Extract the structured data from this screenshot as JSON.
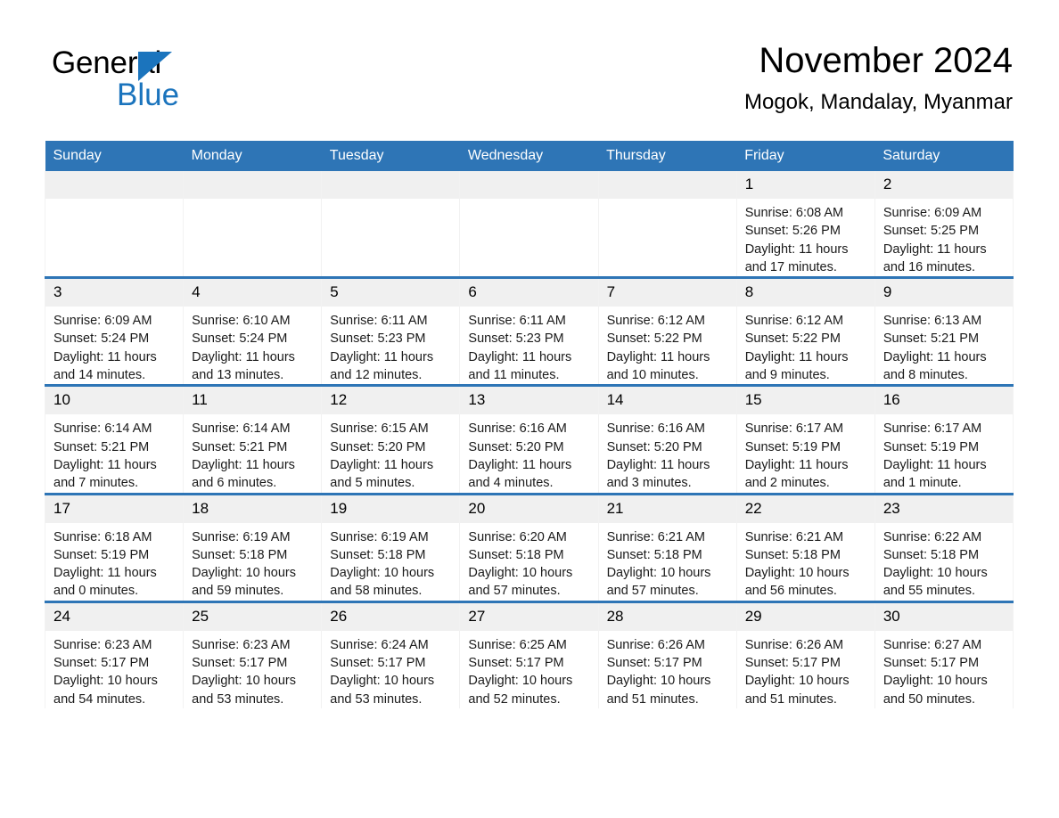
{
  "brand": {
    "name_part1": "General",
    "name_part2": "Blue",
    "triangle_color": "#1b74bd"
  },
  "header": {
    "title": "November 2024",
    "location": "Mogok, Mandalay, Myanmar"
  },
  "theme": {
    "header_blue": "#2e75b6",
    "daynum_bg": "#f0f0f0",
    "text": "#000000"
  },
  "weekday_headers": [
    "Sunday",
    "Monday",
    "Tuesday",
    "Wednesday",
    "Thursday",
    "Friday",
    "Saturday"
  ],
  "labels": {
    "sunrise_prefix": "Sunrise:",
    "sunset_prefix": "Sunset:",
    "daylight_prefix": "Daylight:"
  },
  "weeks": [
    [
      {
        "day": "",
        "sunrise": "",
        "sunset": "",
        "daylight_line1": "",
        "daylight_line2": ""
      },
      {
        "day": "",
        "sunrise": "",
        "sunset": "",
        "daylight_line1": "",
        "daylight_line2": ""
      },
      {
        "day": "",
        "sunrise": "",
        "sunset": "",
        "daylight_line1": "",
        "daylight_line2": ""
      },
      {
        "day": "",
        "sunrise": "",
        "sunset": "",
        "daylight_line1": "",
        "daylight_line2": ""
      },
      {
        "day": "",
        "sunrise": "",
        "sunset": "",
        "daylight_line1": "",
        "daylight_line2": ""
      },
      {
        "day": "1",
        "sunrise": "Sunrise: 6:08 AM",
        "sunset": "Sunset: 5:26 PM",
        "daylight_line1": "Daylight: 11 hours",
        "daylight_line2": "and 17 minutes."
      },
      {
        "day": "2",
        "sunrise": "Sunrise: 6:09 AM",
        "sunset": "Sunset: 5:25 PM",
        "daylight_line1": "Daylight: 11 hours",
        "daylight_line2": "and 16 minutes."
      }
    ],
    [
      {
        "day": "3",
        "sunrise": "Sunrise: 6:09 AM",
        "sunset": "Sunset: 5:24 PM",
        "daylight_line1": "Daylight: 11 hours",
        "daylight_line2": "and 14 minutes."
      },
      {
        "day": "4",
        "sunrise": "Sunrise: 6:10 AM",
        "sunset": "Sunset: 5:24 PM",
        "daylight_line1": "Daylight: 11 hours",
        "daylight_line2": "and 13 minutes."
      },
      {
        "day": "5",
        "sunrise": "Sunrise: 6:11 AM",
        "sunset": "Sunset: 5:23 PM",
        "daylight_line1": "Daylight: 11 hours",
        "daylight_line2": "and 12 minutes."
      },
      {
        "day": "6",
        "sunrise": "Sunrise: 6:11 AM",
        "sunset": "Sunset: 5:23 PM",
        "daylight_line1": "Daylight: 11 hours",
        "daylight_line2": "and 11 minutes."
      },
      {
        "day": "7",
        "sunrise": "Sunrise: 6:12 AM",
        "sunset": "Sunset: 5:22 PM",
        "daylight_line1": "Daylight: 11 hours",
        "daylight_line2": "and 10 minutes."
      },
      {
        "day": "8",
        "sunrise": "Sunrise: 6:12 AM",
        "sunset": "Sunset: 5:22 PM",
        "daylight_line1": "Daylight: 11 hours",
        "daylight_line2": "and 9 minutes."
      },
      {
        "day": "9",
        "sunrise": "Sunrise: 6:13 AM",
        "sunset": "Sunset: 5:21 PM",
        "daylight_line1": "Daylight: 11 hours",
        "daylight_line2": "and 8 minutes."
      }
    ],
    [
      {
        "day": "10",
        "sunrise": "Sunrise: 6:14 AM",
        "sunset": "Sunset: 5:21 PM",
        "daylight_line1": "Daylight: 11 hours",
        "daylight_line2": "and 7 minutes."
      },
      {
        "day": "11",
        "sunrise": "Sunrise: 6:14 AM",
        "sunset": "Sunset: 5:21 PM",
        "daylight_line1": "Daylight: 11 hours",
        "daylight_line2": "and 6 minutes."
      },
      {
        "day": "12",
        "sunrise": "Sunrise: 6:15 AM",
        "sunset": "Sunset: 5:20 PM",
        "daylight_line1": "Daylight: 11 hours",
        "daylight_line2": "and 5 minutes."
      },
      {
        "day": "13",
        "sunrise": "Sunrise: 6:16 AM",
        "sunset": "Sunset: 5:20 PM",
        "daylight_line1": "Daylight: 11 hours",
        "daylight_line2": "and 4 minutes."
      },
      {
        "day": "14",
        "sunrise": "Sunrise: 6:16 AM",
        "sunset": "Sunset: 5:20 PM",
        "daylight_line1": "Daylight: 11 hours",
        "daylight_line2": "and 3 minutes."
      },
      {
        "day": "15",
        "sunrise": "Sunrise: 6:17 AM",
        "sunset": "Sunset: 5:19 PM",
        "daylight_line1": "Daylight: 11 hours",
        "daylight_line2": "and 2 minutes."
      },
      {
        "day": "16",
        "sunrise": "Sunrise: 6:17 AM",
        "sunset": "Sunset: 5:19 PM",
        "daylight_line1": "Daylight: 11 hours",
        "daylight_line2": "and 1 minute."
      }
    ],
    [
      {
        "day": "17",
        "sunrise": "Sunrise: 6:18 AM",
        "sunset": "Sunset: 5:19 PM",
        "daylight_line1": "Daylight: 11 hours",
        "daylight_line2": "and 0 minutes."
      },
      {
        "day": "18",
        "sunrise": "Sunrise: 6:19 AM",
        "sunset": "Sunset: 5:18 PM",
        "daylight_line1": "Daylight: 10 hours",
        "daylight_line2": "and 59 minutes."
      },
      {
        "day": "19",
        "sunrise": "Sunrise: 6:19 AM",
        "sunset": "Sunset: 5:18 PM",
        "daylight_line1": "Daylight: 10 hours",
        "daylight_line2": "and 58 minutes."
      },
      {
        "day": "20",
        "sunrise": "Sunrise: 6:20 AM",
        "sunset": "Sunset: 5:18 PM",
        "daylight_line1": "Daylight: 10 hours",
        "daylight_line2": "and 57 minutes."
      },
      {
        "day": "21",
        "sunrise": "Sunrise: 6:21 AM",
        "sunset": "Sunset: 5:18 PM",
        "daylight_line1": "Daylight: 10 hours",
        "daylight_line2": "and 57 minutes."
      },
      {
        "day": "22",
        "sunrise": "Sunrise: 6:21 AM",
        "sunset": "Sunset: 5:18 PM",
        "daylight_line1": "Daylight: 10 hours",
        "daylight_line2": "and 56 minutes."
      },
      {
        "day": "23",
        "sunrise": "Sunrise: 6:22 AM",
        "sunset": "Sunset: 5:18 PM",
        "daylight_line1": "Daylight: 10 hours",
        "daylight_line2": "and 55 minutes."
      }
    ],
    [
      {
        "day": "24",
        "sunrise": "Sunrise: 6:23 AM",
        "sunset": "Sunset: 5:17 PM",
        "daylight_line1": "Daylight: 10 hours",
        "daylight_line2": "and 54 minutes."
      },
      {
        "day": "25",
        "sunrise": "Sunrise: 6:23 AM",
        "sunset": "Sunset: 5:17 PM",
        "daylight_line1": "Daylight: 10 hours",
        "daylight_line2": "and 53 minutes."
      },
      {
        "day": "26",
        "sunrise": "Sunrise: 6:24 AM",
        "sunset": "Sunset: 5:17 PM",
        "daylight_line1": "Daylight: 10 hours",
        "daylight_line2": "and 53 minutes."
      },
      {
        "day": "27",
        "sunrise": "Sunrise: 6:25 AM",
        "sunset": "Sunset: 5:17 PM",
        "daylight_line1": "Daylight: 10 hours",
        "daylight_line2": "and 52 minutes."
      },
      {
        "day": "28",
        "sunrise": "Sunrise: 6:26 AM",
        "sunset": "Sunset: 5:17 PM",
        "daylight_line1": "Daylight: 10 hours",
        "daylight_line2": "and 51 minutes."
      },
      {
        "day": "29",
        "sunrise": "Sunrise: 6:26 AM",
        "sunset": "Sunset: 5:17 PM",
        "daylight_line1": "Daylight: 10 hours",
        "daylight_line2": "and 51 minutes."
      },
      {
        "day": "30",
        "sunrise": "Sunrise: 6:27 AM",
        "sunset": "Sunset: 5:17 PM",
        "daylight_line1": "Daylight: 10 hours",
        "daylight_line2": "and 50 minutes."
      }
    ]
  ]
}
